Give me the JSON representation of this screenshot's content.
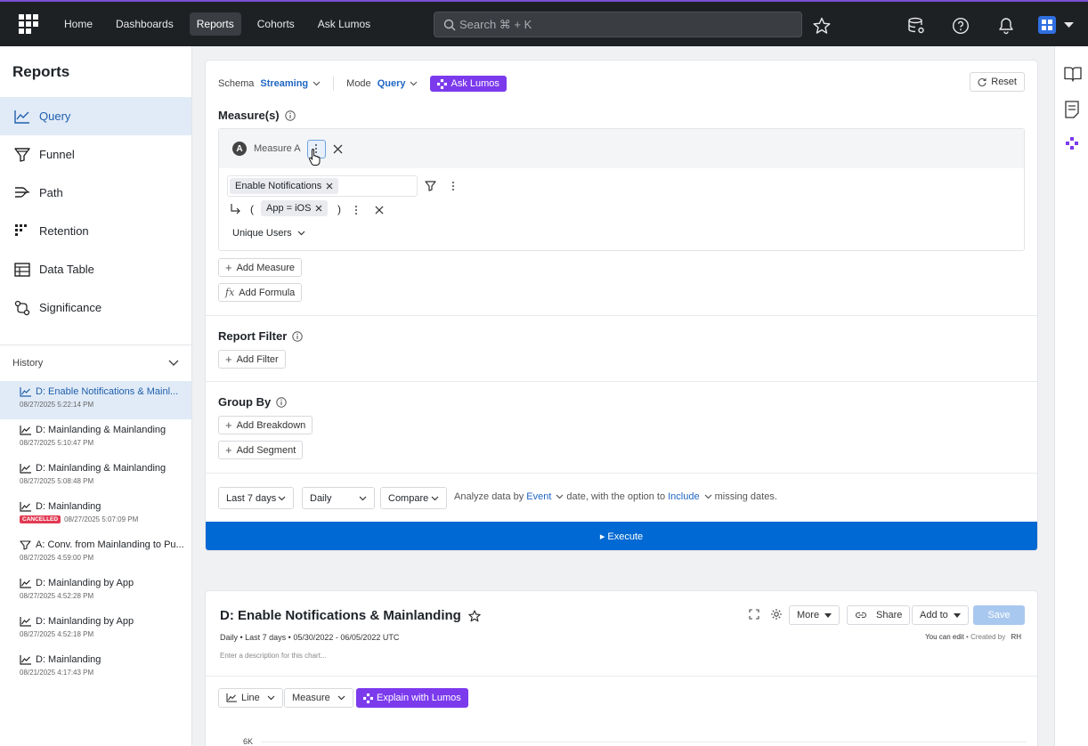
{
  "topnav": {
    "items": [
      "Home",
      "Dashboards",
      "Reports",
      "Cohorts",
      "Ask Lumos"
    ],
    "active": "Reports",
    "search_placeholder": "Search ⌘ + K"
  },
  "sidebar": {
    "title": "Reports",
    "items": [
      {
        "label": "Query",
        "icon": "line-chart-icon",
        "active": true
      },
      {
        "label": "Funnel",
        "icon": "funnel-icon"
      },
      {
        "label": "Path",
        "icon": "path-icon"
      },
      {
        "label": "Retention",
        "icon": "retention-grid-icon"
      },
      {
        "label": "Data Table",
        "icon": "table-icon"
      },
      {
        "label": "Significance",
        "icon": "significance-icon"
      }
    ],
    "history_label": "History",
    "history": [
      {
        "title": "D: Enable Notifications & Mainl...",
        "date": "08/27/2025 5:22:14 PM",
        "icon": "line-chart-icon",
        "active": true
      },
      {
        "title": "D: Mainlanding & Mainlanding",
        "date": "08/27/2025 5:10:47 PM",
        "icon": "line-chart-icon"
      },
      {
        "title": "D: Mainlanding & Mainlanding",
        "date": "08/27/2025 5:08:48 PM",
        "icon": "line-chart-icon"
      },
      {
        "title": "D: Mainlanding",
        "date": "08/27/2025 5:07:09 PM",
        "icon": "line-chart-icon",
        "badge": "CANCELLED"
      },
      {
        "title": "A: Conv. from Mainlanding to Pu...",
        "date": "08/27/2025 4:59:00 PM",
        "icon": "funnel-icon"
      },
      {
        "title": "D: Mainlanding by App",
        "date": "08/27/2025 4:52:28 PM",
        "icon": "line-chart-icon"
      },
      {
        "title": "D: Mainlanding by App",
        "date": "08/27/2025 4:52:18 PM",
        "icon": "line-chart-icon"
      },
      {
        "title": "D: Mainlanding",
        "date": "08/21/2025 4:17:43 PM",
        "icon": "line-chart-icon"
      }
    ]
  },
  "query": {
    "schema_label": "Schema",
    "schema_value": "Streaming",
    "mode_label": "Mode",
    "mode_value": "Query",
    "ask_lumos": "Ask Lumos",
    "reset": "Reset",
    "measures_title": "Measure(s)",
    "measure_letter": "A",
    "measure_name": "Measure A",
    "event_chip": "Enable Notifications",
    "open_paren": "(",
    "close_paren": ")",
    "filter_chip": "App = iOS",
    "aggregation": "Unique Users",
    "add_measure": "Add Measure",
    "add_formula": "Add Formula",
    "report_filter_title": "Report Filter",
    "add_filter": "Add Filter",
    "group_by_title": "Group By",
    "add_breakdown": "Add Breakdown",
    "add_segment": "Add Segment",
    "range": "Last 7 days",
    "granularity": "Daily",
    "compare": "Compare",
    "analyze_prefix": "Analyze data by",
    "analyze_event": "Event",
    "analyze_mid": "date, with the option to",
    "analyze_include": "Include",
    "analyze_suffix": "missing dates.",
    "execute": "▸ Execute"
  },
  "chart_panel": {
    "title": "D: Enable Notifications & Mainlanding",
    "subtitle": "Daily • Last 7 days • 05/30/2022 - 06/05/2022 UTC",
    "description_placeholder": "Enter a description for this chart...",
    "more": "More",
    "share": "Share",
    "add_to": "Add to",
    "save": "Save",
    "edit_note": "You can edit",
    "created_by": "• Created by",
    "creator": "RH",
    "chart_type": "Line",
    "measure_dd": "Measure",
    "explain": "Explain with Lumos",
    "y_tick": "6K"
  },
  "colors": {
    "accent_blue": "#0069d3",
    "lumos_purple": "#7c3aed",
    "topbar": "#1e2124",
    "cancelled": "#e23b53"
  }
}
